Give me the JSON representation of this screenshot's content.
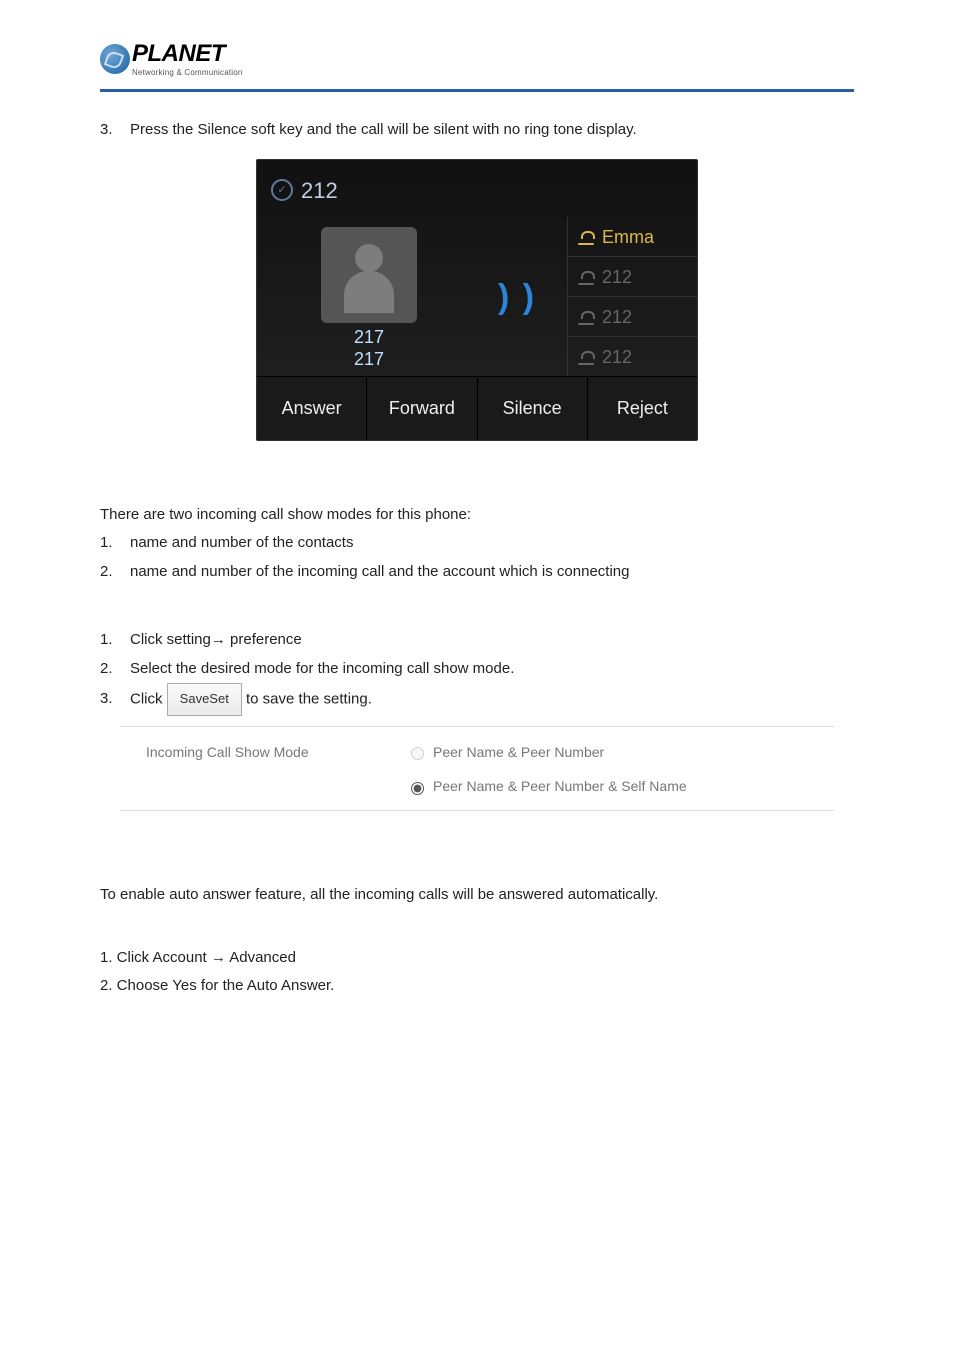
{
  "logo": {
    "brand": "PLANET",
    "tagline": "Networking & Communication"
  },
  "step3": {
    "idx": "3.",
    "text": "Press the Silence soft key and the call will be silent with no ring tone display."
  },
  "phone": {
    "title": "212",
    "caller_num1": "217",
    "caller_num2": "217",
    "lines": [
      {
        "label": "Emma"
      },
      {
        "label": "212"
      },
      {
        "label": "212"
      },
      {
        "label": "212"
      }
    ],
    "softkeys": [
      "Answer",
      "Forward",
      "Silence",
      "Reject"
    ]
  },
  "modes_intro": "There are two incoming call show modes for this phone:",
  "modes": [
    {
      "idx": "1.",
      "text": "name and number of the contacts"
    },
    {
      "idx": "2.",
      "text": "name and number of the incoming call and the account which is connecting"
    }
  ],
  "steps": [
    {
      "idx": "1.",
      "text": "Click setting→ preference"
    },
    {
      "idx": "2.",
      "text": "Select the desired mode for the incoming call show mode."
    }
  ],
  "step_click": {
    "idx": "3.",
    "pre": "Click ",
    "btn": "SaveSet",
    "post": " to save the setting."
  },
  "setting": {
    "label": "Incoming Call Show Mode",
    "opt1": "Peer Name & Peer Number",
    "opt2": "Peer Name & Peer Number & Self Name"
  },
  "autoanswer_intro": "To enable auto answer feature, all the incoming calls will be answered automatically.",
  "autoanswer_steps": [
    "1. Click Account → Advanced",
    "2. Choose Yes for the Auto Answer."
  ]
}
